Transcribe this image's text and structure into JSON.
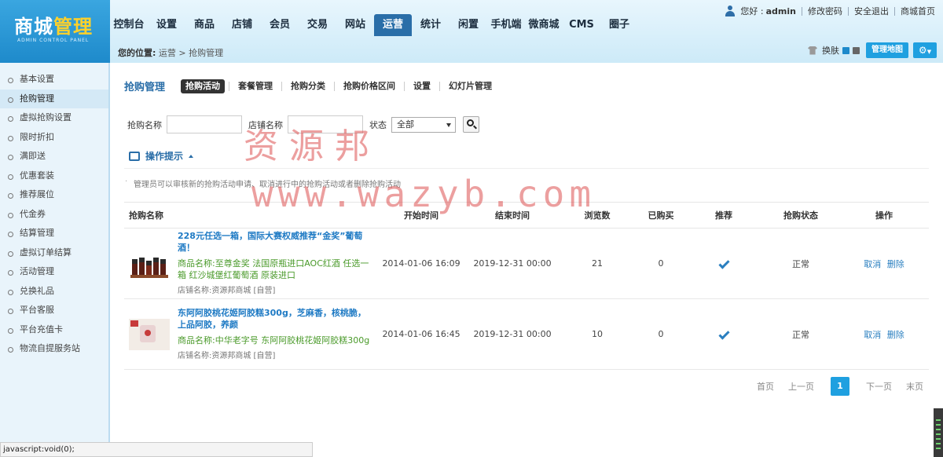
{
  "header": {
    "logo_main": "商城",
    "logo_accent": "管理",
    "logo_sub": "ADMIN CONTROL PANEL",
    "nav": [
      "控制台",
      "设置",
      "商品",
      "店铺",
      "会员",
      "交易",
      "网站",
      "运营",
      "统计",
      "闲置",
      "手机端",
      "微商城",
      "CMS",
      "圈子"
    ],
    "active_nav": "运营",
    "greeting": "您好 :",
    "username": "admin",
    "links": [
      "修改密码",
      "安全退出",
      "商城首页"
    ]
  },
  "breadcrumb": {
    "label": "您的位置:",
    "path": "运营 > 抢购管理"
  },
  "toolbar": {
    "skin_label": "换肤",
    "skin_colors": [
      "#1e8acb",
      "#666666"
    ],
    "map_button": "管理地图",
    "gear_icon": "gear-icon"
  },
  "sidebar": {
    "items": [
      "基本设置",
      "抢购管理",
      "虚拟抢购设置",
      "限时折扣",
      "满即送",
      "优惠套装",
      "推荐展位",
      "代金券",
      "结算管理",
      "虚拟订单结算",
      "活动管理",
      "兑换礼品",
      "平台客服",
      "平台充值卡",
      "物流自提服务站"
    ],
    "active": "抢购管理"
  },
  "page": {
    "title": "抢购管理",
    "tabs": [
      "抢购活动",
      "套餐管理",
      "抢购分类",
      "抢购价格区间",
      "设置",
      "幻灯片管理"
    ],
    "active_tab": "抢购活动"
  },
  "filter": {
    "name_label": "抢购名称",
    "name_value": "",
    "shop_label": "店铺名称",
    "shop_value": "",
    "status_label": "状态",
    "status_value": "全部"
  },
  "tips": {
    "title": "操作提示",
    "text": "管理员可以审核新的抢购活动申请、取消进行中的抢购活动或者删除抢购活动"
  },
  "table": {
    "headers": {
      "name": "抢购名称",
      "start": "开始时间",
      "end": "结束时间",
      "views": "浏览数",
      "bought": "已购买",
      "recommend": "推荐",
      "status": "抢购状态",
      "ops": "操作"
    },
    "rows": [
      {
        "title": "228元任选一箱，国际大赛权威推荐“金奖”葡萄酒！",
        "goods": "商品名称:至尊金奖 法国原瓶进口AOC红酒 任选一箱 红沙城堡红葡萄酒 原装进口",
        "shop": "店铺名称:资源邦商城 [自营]",
        "start": "2014-01-06 16:09",
        "end": "2019-12-31 00:00",
        "views": "21",
        "bought": "0",
        "recommend": true,
        "status": "正常",
        "cancel": "取消",
        "delete": "删除"
      },
      {
        "title": "东阿阿胶桃花姬阿胶糕300g，芝麻香，核桃脆，上品阿胶，养颜",
        "goods": "商品名称:中华老字号 东阿阿胶桃花姬阿胶糕300g",
        "shop": "店铺名称:资源邦商城 [自营]",
        "start": "2014-01-06 16:45",
        "end": "2019-12-31 00:00",
        "views": "10",
        "bought": "0",
        "recommend": true,
        "status": "正常",
        "cancel": "取消",
        "delete": "删除"
      }
    ]
  },
  "pager": {
    "first": "首页",
    "prev": "上一页",
    "current": "1",
    "next": "下一页",
    "last": "末页"
  },
  "watermark": {
    "line1": "资源邦",
    "line2": "www.wazyb.com"
  },
  "status_bar": "javascript:void(0);"
}
